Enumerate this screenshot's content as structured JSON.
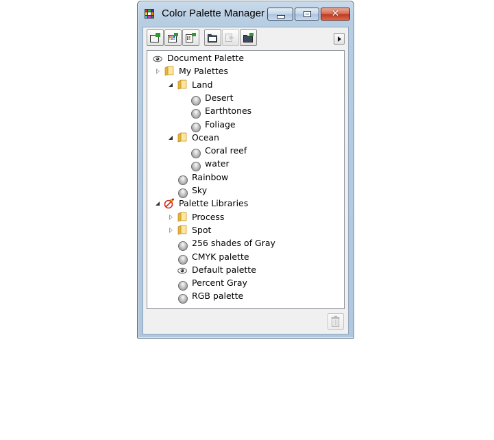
{
  "window": {
    "title": "Color Palette Manager",
    "icons": {
      "app": "palette-grid-icon",
      "minimize": "minimize-icon",
      "maximize": "maximize-icon",
      "close": "close-icon"
    }
  },
  "toolbar": {
    "buttons": [
      {
        "id": "new-palette",
        "icon": "new-palette-icon",
        "enabled": true
      },
      {
        "id": "new-palette-from-selection",
        "icon": "palette-from-selection-icon",
        "enabled": true
      },
      {
        "id": "new-palette-from-document",
        "icon": "palette-from-document-icon",
        "enabled": true
      },
      {
        "id": "open-palette",
        "icon": "open-folder-icon",
        "enabled": true
      },
      {
        "id": "import-palette",
        "icon": "import-icon",
        "enabled": false
      },
      {
        "id": "new-folder",
        "icon": "new-folder-icon",
        "enabled": true
      }
    ],
    "flyout_icon": "flyout-arrow-icon"
  },
  "tree": {
    "items": [
      {
        "label": "Document Palette",
        "level": 0,
        "icon": "eye-icon",
        "expander": "none"
      },
      {
        "label": "My Palettes",
        "level": 0,
        "icon": "folder-icon",
        "expander": "closed"
      },
      {
        "label": "Land",
        "level": 1,
        "icon": "folder-icon",
        "expander": "open"
      },
      {
        "label": "Desert",
        "level": 2,
        "icon": "palette-icon",
        "expander": "none"
      },
      {
        "label": "Earthtones",
        "level": 2,
        "icon": "palette-icon",
        "expander": "none"
      },
      {
        "label": "Foliage",
        "level": 2,
        "icon": "palette-icon",
        "expander": "none"
      },
      {
        "label": "Ocean",
        "level": 1,
        "icon": "folder-icon",
        "expander": "open"
      },
      {
        "label": "Coral reef",
        "level": 2,
        "icon": "palette-icon",
        "expander": "none"
      },
      {
        "label": "water",
        "level": 2,
        "icon": "palette-icon",
        "expander": "none"
      },
      {
        "label": "Rainbow",
        "level": 1,
        "icon": "palette-icon",
        "expander": "none"
      },
      {
        "label": "Sky",
        "level": 1,
        "icon": "palette-icon",
        "expander": "none"
      },
      {
        "label": "Palette Libraries",
        "level": 0,
        "icon": "libraries-icon",
        "expander": "open"
      },
      {
        "label": "Process",
        "level": 1,
        "icon": "folder-icon",
        "expander": "closed"
      },
      {
        "label": "Spot",
        "level": 1,
        "icon": "folder-icon",
        "expander": "closed"
      },
      {
        "label": "256 shades of Gray",
        "level": 1,
        "icon": "palette-icon",
        "expander": "none"
      },
      {
        "label": "CMYK palette",
        "level": 1,
        "icon": "palette-icon",
        "expander": "none"
      },
      {
        "label": "Default palette",
        "level": 1,
        "icon": "eye-icon",
        "expander": "none"
      },
      {
        "label": "Percent Gray",
        "level": 1,
        "icon": "palette-icon",
        "expander": "none"
      },
      {
        "label": "RGB palette",
        "level": 1,
        "icon": "palette-icon",
        "expander": "none"
      }
    ]
  },
  "status": {
    "delete_icon": "trash-icon",
    "delete_enabled": false
  }
}
